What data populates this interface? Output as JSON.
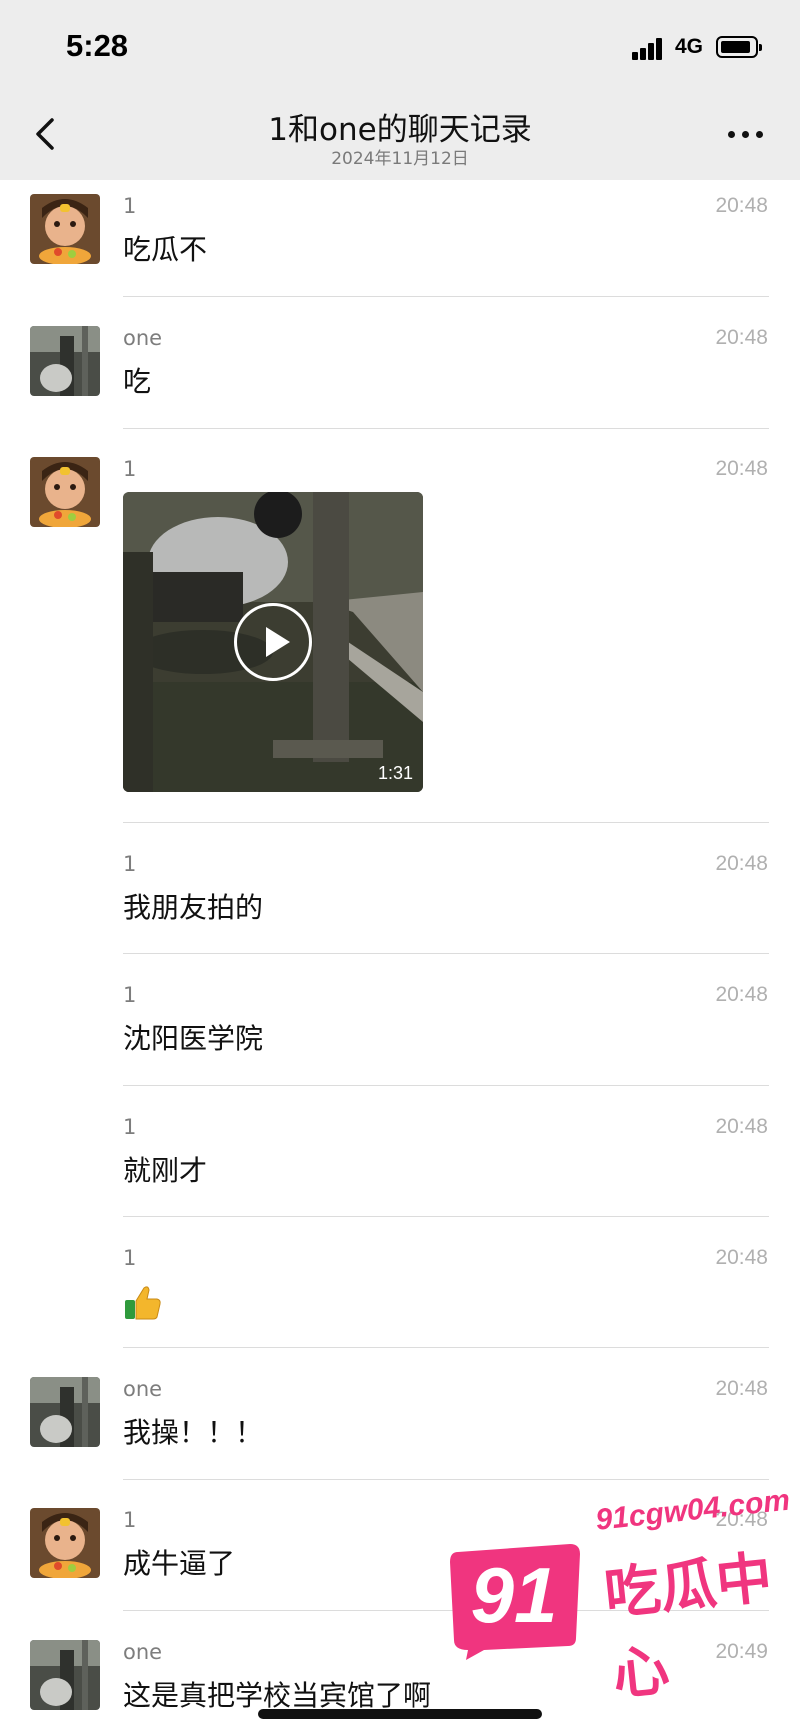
{
  "status_bar": {
    "time": "5:28",
    "network": "4G"
  },
  "nav": {
    "title": "1和one的聊天记录",
    "subtitle": "2024年11月12日"
  },
  "messages": [
    {
      "sender": "1",
      "time": "20:48",
      "text": "吃瓜不"
    },
    {
      "sender": "one",
      "time": "20:48",
      "text": "吃"
    },
    {
      "sender": "1",
      "time": "20:48",
      "video_duration": "1:31"
    },
    {
      "sender": "1",
      "time": "20:48",
      "text": "我朋友拍的"
    },
    {
      "sender": "1",
      "time": "20:48",
      "text": "沈阳医学院"
    },
    {
      "sender": "1",
      "time": "20:48",
      "text": "就刚才"
    },
    {
      "sender": "1",
      "time": "20:48",
      "emoji": "thumbs-up-icon"
    },
    {
      "sender": "one",
      "time": "20:48",
      "text": "我操！！！"
    },
    {
      "sender": "1",
      "time": "20:48",
      "text": "成牛逼了"
    },
    {
      "sender": "one",
      "time": "20:49",
      "text": "这是真把学校当宾馆了啊"
    }
  ],
  "watermark": {
    "number": "91",
    "url": "91cgw04.com",
    "text": "吃瓜中心"
  },
  "colors": {
    "header_bg": "#ededed",
    "divider": "#dcdcdc",
    "watermark": "#f0357f"
  }
}
